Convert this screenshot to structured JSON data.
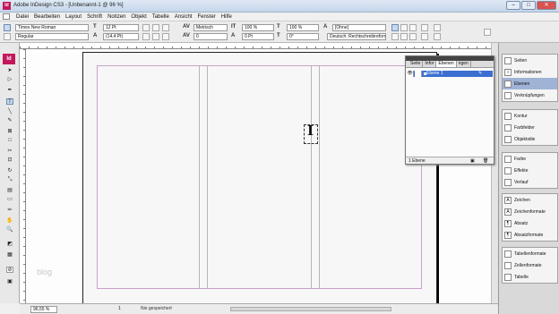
{
  "window": {
    "title": "Adobe InDesign CS3 - [Unbenannt-1 @ 96 %]",
    "app_logo": "Id"
  },
  "menu": [
    "Datei",
    "Bearbeiten",
    "Layout",
    "Schrift",
    "Notizen",
    "Objekt",
    "Tabelle",
    "Ansicht",
    "Fenster",
    "Hilfe"
  ],
  "control": {
    "font_family": "Times New Roman",
    "font_style": "Regular",
    "font_size": "12 Pt",
    "leading": "(14,4 Pt)",
    "kerning": "Metrisch",
    "tracking": "0",
    "v_scale": "100 %",
    "h_scale": "100 %",
    "baseline": "0 Pt",
    "skew": "0°",
    "char_style": "[Ohne]",
    "language": "Deutsch: Rechtschreibreform"
  },
  "status": {
    "zoom": "96,55 %",
    "page": "1",
    "save_state": "Nie gespeichert"
  },
  "canvas": {
    "watermark": "blog"
  },
  "layers_panel": {
    "tabs": [
      "Seite",
      "Infor",
      "Ebenen",
      "ngen"
    ],
    "active_tab": "Ebenen",
    "layer_name": "Ebene 1",
    "footer_count": "1 Ebene"
  },
  "dock": {
    "group1": [
      "Seiten",
      "Informationen",
      "Ebenen",
      "Verknüpfungen"
    ],
    "group1_active": "Ebenen",
    "group2": [
      "Kontur",
      "Farbfelder",
      "Objektstile"
    ],
    "group3": [
      "Farbe",
      "Effekte",
      "Verlauf"
    ],
    "group4": [
      "Zeichen",
      "Zeichenformate",
      "Absatz",
      "Absatzformate"
    ],
    "group5": [
      "Tabellenformate",
      "Zellenformate",
      "Tabelle"
    ]
  },
  "colors": {
    "brand": "#c2185b",
    "selection": "#3b6fd1",
    "dock_active": "#9fb3d6"
  }
}
